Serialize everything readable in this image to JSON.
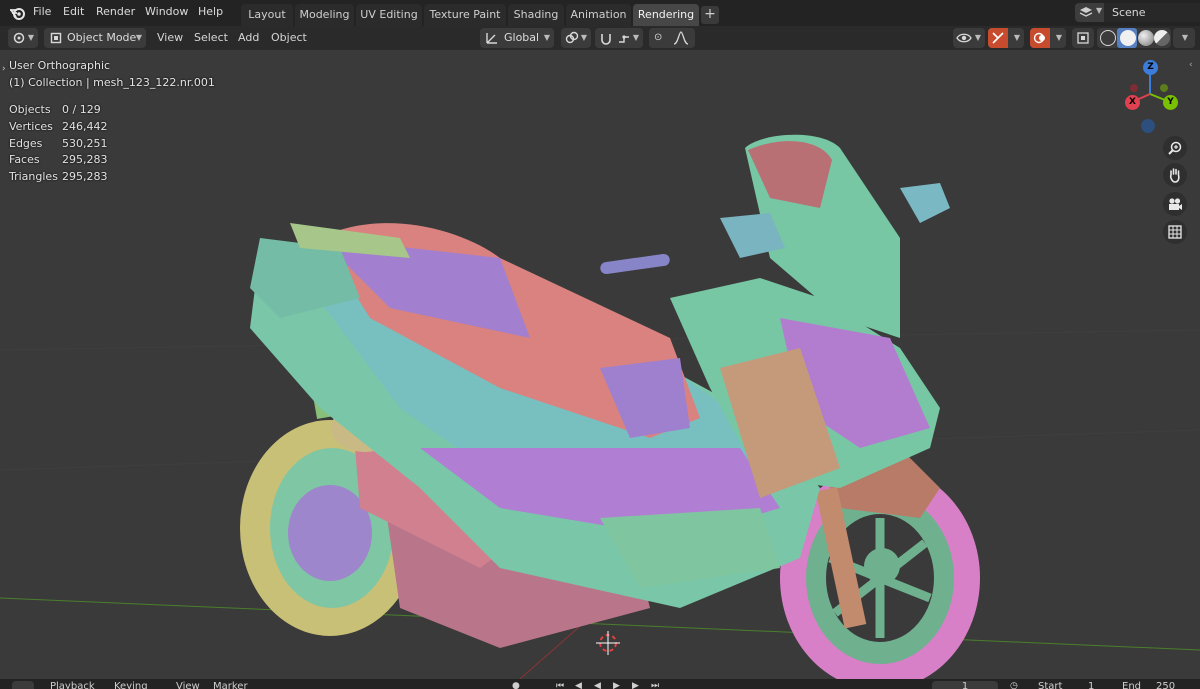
{
  "topbar": {
    "menus": [
      "File",
      "Edit",
      "Render",
      "Window",
      "Help"
    ],
    "tabs": [
      {
        "label": "Layout",
        "active": false
      },
      {
        "label": "Modeling",
        "active": false
      },
      {
        "label": "UV Editing",
        "active": false
      },
      {
        "label": "Texture Paint",
        "active": false
      },
      {
        "label": "Shading",
        "active": false
      },
      {
        "label": "Animation",
        "active": false
      },
      {
        "label": "Rendering",
        "active": true
      }
    ],
    "add_tab": "+",
    "scene_name": "Scene"
  },
  "header": {
    "mode": "Object Mode",
    "menus": [
      "View",
      "Select",
      "Add",
      "Object"
    ],
    "transform_orientation": "Global"
  },
  "viewport": {
    "view_name": "User Orthographic",
    "collection_info": "(1) Collection | mesh_123_122.nr.001",
    "stats": [
      {
        "label": "Objects",
        "value": "0 / 129"
      },
      {
        "label": "Vertices",
        "value": "246,442"
      },
      {
        "label": "Edges",
        "value": "530,251"
      },
      {
        "label": "Faces",
        "value": "295,283"
      },
      {
        "label": "Triangles",
        "value": "295,283"
      }
    ],
    "gizmo": {
      "x": "X",
      "y": "Y",
      "z": "Z"
    },
    "axis_colors": {
      "x": "#e0404f",
      "y": "#79c000",
      "z": "#3c7ddb"
    }
  },
  "timeline": {
    "menus": [
      "Playback",
      "Keying",
      "View",
      "Marker"
    ],
    "current_frame": "1",
    "start_label": "Start",
    "start_value": "1",
    "end_label": "End",
    "end_value": "250"
  },
  "icons": [
    "blender-logo-icon",
    "editor-type-icon",
    "object-mode-icon",
    "transform-icon",
    "link-icon",
    "snap-icon",
    "proportional-icon",
    "visibility-icon",
    "gizmo-icon",
    "overlay-icon",
    "xray-icon",
    "wireframe-shading-icon",
    "solid-shading-icon",
    "material-shading-icon",
    "rendered-shading-icon",
    "zoom-icon",
    "pan-hand-icon",
    "camera-icon",
    "grid-view-icon"
  ]
}
